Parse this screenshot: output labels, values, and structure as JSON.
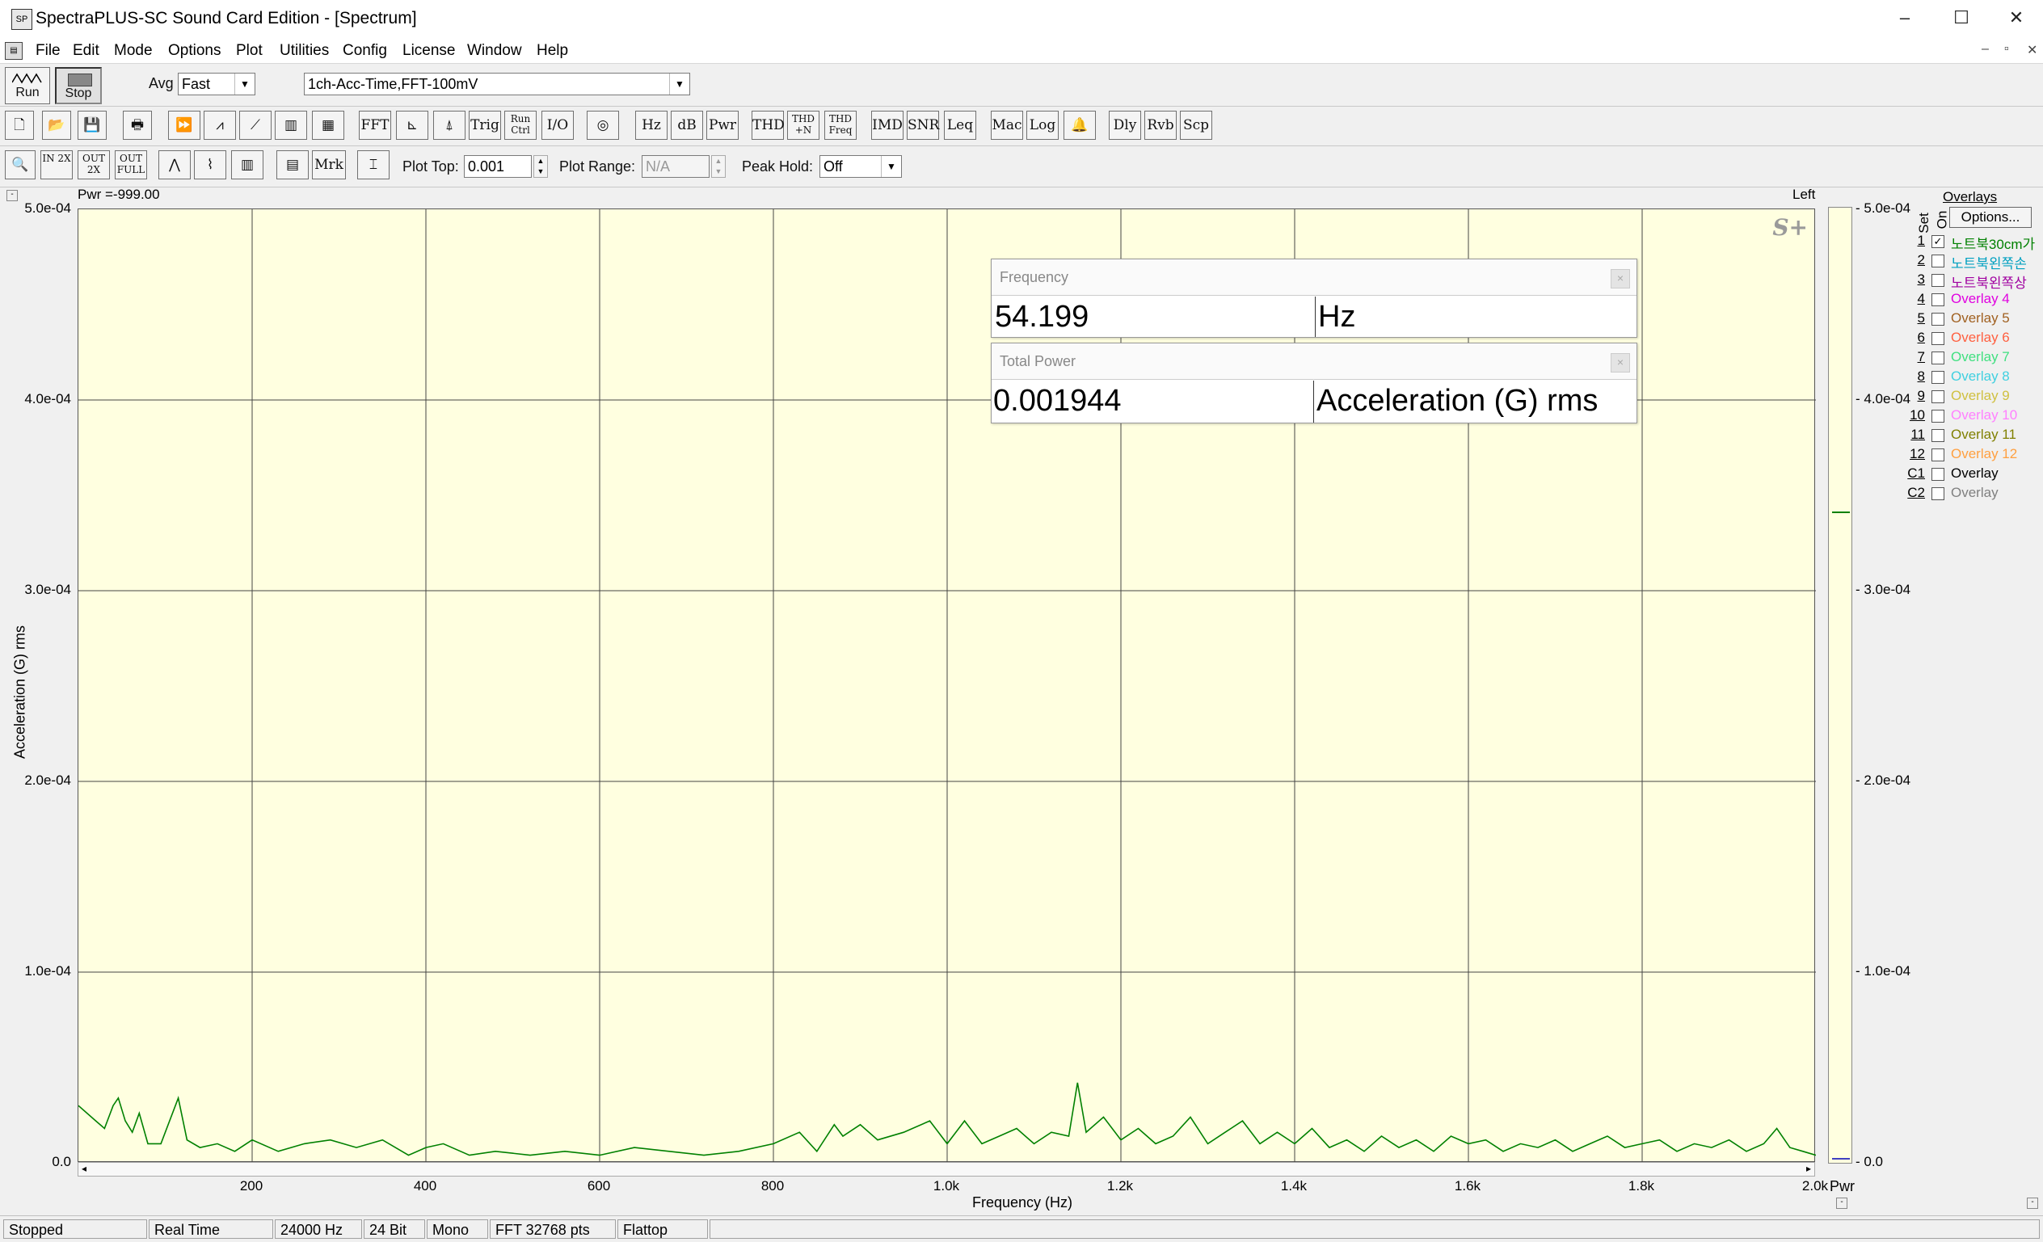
{
  "window": {
    "title": "SpectraPLUS-SC Sound Card Edition - [Spectrum]",
    "app_icon": "spectraplus-app-icon",
    "controls": [
      "–",
      "☐",
      "✕"
    ],
    "mdi_controls": [
      "–",
      "▫",
      "✕"
    ]
  },
  "menu": [
    "File",
    "Edit",
    "Mode",
    "Options",
    "Plot",
    "Utilities",
    "Config",
    "License",
    "Window",
    "Help"
  ],
  "toolbar1": {
    "run_label": "Run",
    "stop_label": "Stop",
    "avg_label": "Avg",
    "avg_value": "Fast",
    "config_value": "1ch-Acc-Time,FFT-100mV"
  },
  "toolbar2": {
    "buttons": [
      "FFT",
      "Trig",
      "Run Ctrl",
      "I/O",
      "Hz",
      "dB",
      "Pwr",
      "THD",
      "THD +N",
      "THD Freq",
      "IMD",
      "SNR",
      "Leq",
      "Mac",
      "Log",
      "Dly",
      "Rvb",
      "Scp"
    ]
  },
  "toolbar3": {
    "mrk_label": "Mrk",
    "zoom_labels": [
      "IN 2X",
      "OUT 2X",
      "OUT FULL"
    ],
    "plot_top_label": "Plot Top:",
    "plot_top_value": "0.001",
    "plot_range_label": "Plot Range:",
    "plot_range_value": "N/A",
    "peak_hold_label": "Peak Hold:",
    "peak_hold_value": "Off"
  },
  "plot": {
    "pwr_readout": "Pwr =-999.00",
    "channel_label": "Left",
    "logo": "S+",
    "right_axis_label": "Pwr"
  },
  "readouts": {
    "frequency": {
      "header": "Frequency",
      "value": "54.199",
      "unit": "Hz"
    },
    "total_power": {
      "header": "Total Power",
      "value": "0.001944",
      "unit": "Acceleration (G) rms"
    }
  },
  "overlays": {
    "title": "Overlays",
    "set_label": "Set",
    "on_label": "On",
    "options_button": "Options...",
    "items": [
      {
        "num": "1",
        "label": "노트북30cm가",
        "checked": true,
        "color": "#008000"
      },
      {
        "num": "2",
        "label": "노트북왼쪽손",
        "checked": false,
        "color": "#00a0c0"
      },
      {
        "num": "3",
        "label": "노트북왼쪽상",
        "checked": false,
        "color": "#a000a0"
      },
      {
        "num": "4",
        "label": "Overlay 4",
        "checked": false,
        "color": "#e000e0"
      },
      {
        "num": "5",
        "label": "Overlay 5",
        "checked": false,
        "color": "#a06020"
      },
      {
        "num": "6",
        "label": "Overlay 6",
        "checked": false,
        "color": "#ff6040"
      },
      {
        "num": "7",
        "label": "Overlay 7",
        "checked": false,
        "color": "#40e080"
      },
      {
        "num": "8",
        "label": "Overlay 8",
        "checked": false,
        "color": "#40d0e0"
      },
      {
        "num": "9",
        "label": "Overlay 9",
        "checked": false,
        "color": "#d0c040"
      },
      {
        "num": "10",
        "label": "Overlay 10",
        "checked": false,
        "color": "#ff80ff"
      },
      {
        "num": "11",
        "label": "Overlay 11",
        "checked": false,
        "color": "#808000"
      },
      {
        "num": "12",
        "label": "Overlay 12",
        "checked": false,
        "color": "#ffa040"
      },
      {
        "num": "C1",
        "label": "Overlay",
        "checked": false,
        "color": "#000000"
      },
      {
        "num": "C2",
        "label": "Overlay",
        "checked": false,
        "color": "#808080"
      }
    ]
  },
  "status": [
    "Stopped",
    "Real Time",
    "24000 Hz",
    "24 Bit",
    "Mono",
    "FFT 32768 pts",
    "Flattop"
  ],
  "chart_data": {
    "type": "line",
    "xlabel": "Frequency (Hz)",
    "ylabel": "Acceleration (G) rms",
    "xlim": [
      0,
      2000
    ],
    "ylim": [
      0,
      0.0005
    ],
    "x_ticks": [
      "200",
      "400",
      "600",
      "800",
      "1.0k",
      "1.2k",
      "1.4k",
      "1.6k",
      "1.8k",
      "2.0k"
    ],
    "y_ticks": [
      "0.0",
      "1.0e-04",
      "2.0e-04",
      "3.0e-04",
      "4.0e-04",
      "5.0e-04"
    ],
    "grid": true,
    "line_color": "#008000",
    "series": [
      {
        "name": "",
        "points": [
          [
            0,
            3e-05
          ],
          [
            20,
            2.2e-05
          ],
          [
            30,
            1.8e-05
          ],
          [
            40,
            3e-05
          ],
          [
            46,
            3.4e-05
          ],
          [
            54,
            2.2e-05
          ],
          [
            62,
            1.6e-05
          ],
          [
            70,
            2.6e-05
          ],
          [
            80,
            1e-05
          ],
          [
            95,
            1e-05
          ],
          [
            115,
            3.4e-05
          ],
          [
            125,
            1.2e-05
          ],
          [
            140,
            8e-06
          ],
          [
            160,
            1e-05
          ],
          [
            180,
            6e-06
          ],
          [
            200,
            1.2e-05
          ],
          [
            230,
            6e-06
          ],
          [
            260,
            1e-05
          ],
          [
            290,
            1.2e-05
          ],
          [
            320,
            8e-06
          ],
          [
            350,
            1.2e-05
          ],
          [
            380,
            4e-06
          ],
          [
            400,
            8e-06
          ],
          [
            420,
            1e-05
          ],
          [
            450,
            4e-06
          ],
          [
            480,
            6e-06
          ],
          [
            520,
            4e-06
          ],
          [
            560,
            6e-06
          ],
          [
            600,
            4e-06
          ],
          [
            640,
            8e-06
          ],
          [
            680,
            6e-06
          ],
          [
            720,
            4e-06
          ],
          [
            760,
            6e-06
          ],
          [
            800,
            1e-05
          ],
          [
            830,
            1.6e-05
          ],
          [
            850,
            6e-06
          ],
          [
            870,
            2e-05
          ],
          [
            880,
            1.4e-05
          ],
          [
            900,
            2e-05
          ],
          [
            920,
            1.2e-05
          ],
          [
            950,
            1.6e-05
          ],
          [
            980,
            2.2e-05
          ],
          [
            1000,
            1e-05
          ],
          [
            1020,
            2.2e-05
          ],
          [
            1040,
            1e-05
          ],
          [
            1060,
            1.4e-05
          ],
          [
            1080,
            1.8e-05
          ],
          [
            1100,
            1e-05
          ],
          [
            1120,
            1.6e-05
          ],
          [
            1140,
            1.4e-05
          ],
          [
            1150,
            4.2e-05
          ],
          [
            1160,
            1.6e-05
          ],
          [
            1180,
            2.4e-05
          ],
          [
            1200,
            1.2e-05
          ],
          [
            1220,
            1.8e-05
          ],
          [
            1240,
            1e-05
          ],
          [
            1260,
            1.4e-05
          ],
          [
            1280,
            2.4e-05
          ],
          [
            1300,
            1e-05
          ],
          [
            1320,
            1.6e-05
          ],
          [
            1340,
            2.2e-05
          ],
          [
            1360,
            1e-05
          ],
          [
            1380,
            1.6e-05
          ],
          [
            1400,
            1e-05
          ],
          [
            1420,
            1.8e-05
          ],
          [
            1440,
            8e-06
          ],
          [
            1460,
            1.2e-05
          ],
          [
            1480,
            6e-06
          ],
          [
            1500,
            1.4e-05
          ],
          [
            1520,
            8e-06
          ],
          [
            1540,
            1.2e-05
          ],
          [
            1560,
            6e-06
          ],
          [
            1580,
            1.4e-05
          ],
          [
            1600,
            1e-05
          ],
          [
            1620,
            1.2e-05
          ],
          [
            1640,
            6e-06
          ],
          [
            1660,
            1e-05
          ],
          [
            1680,
            8e-06
          ],
          [
            1700,
            1.2e-05
          ],
          [
            1720,
            6e-06
          ],
          [
            1740,
            1e-05
          ],
          [
            1760,
            1.4e-05
          ],
          [
            1780,
            8e-06
          ],
          [
            1800,
            1e-05
          ],
          [
            1820,
            1.2e-05
          ],
          [
            1840,
            6e-06
          ],
          [
            1860,
            1e-05
          ],
          [
            1880,
            8e-06
          ],
          [
            1900,
            1.2e-05
          ],
          [
            1920,
            6e-06
          ],
          [
            1940,
            1e-05
          ],
          [
            1955,
            1.8e-05
          ],
          [
            1970,
            8e-06
          ],
          [
            1985,
            6e-06
          ],
          [
            2000,
            4e-06
          ]
        ]
      }
    ]
  }
}
